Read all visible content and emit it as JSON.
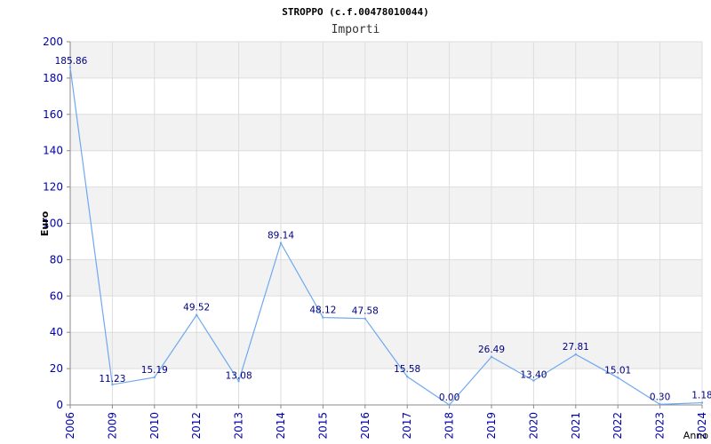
{
  "chart_data": {
    "type": "line",
    "title": "STROPPO (c.f.00478010044)",
    "subtitle": "Importi",
    "xlabel": "Anno",
    "ylabel": "Euro",
    "ylim": [
      0,
      200
    ],
    "yticks": [
      "0",
      "20",
      "40",
      "60",
      "80",
      "100",
      "120",
      "140",
      "160",
      "180",
      "200"
    ],
    "categories": [
      "2006",
      "2009",
      "2010",
      "2012",
      "2013",
      "2014",
      "2015",
      "2016",
      "2017",
      "2018",
      "2019",
      "2020",
      "2021",
      "2022",
      "2023",
      "2024"
    ],
    "values": [
      185.86,
      11.23,
      15.19,
      49.52,
      13.08,
      89.14,
      48.12,
      47.58,
      15.58,
      0.0,
      26.49,
      13.4,
      27.81,
      15.01,
      0.3,
      1.18
    ],
    "labels": [
      "185.86",
      "11.23",
      "15.19",
      "49.52",
      "13.08",
      "89.14",
      "48.12",
      "47.58",
      "15.58",
      "0.00",
      "26.49",
      "13.40",
      "27.81",
      "15.01",
      "0.30",
      "1.18"
    ],
    "grid": true,
    "line_color": "#6fa8f0",
    "band_color": "#f2f2f2"
  }
}
